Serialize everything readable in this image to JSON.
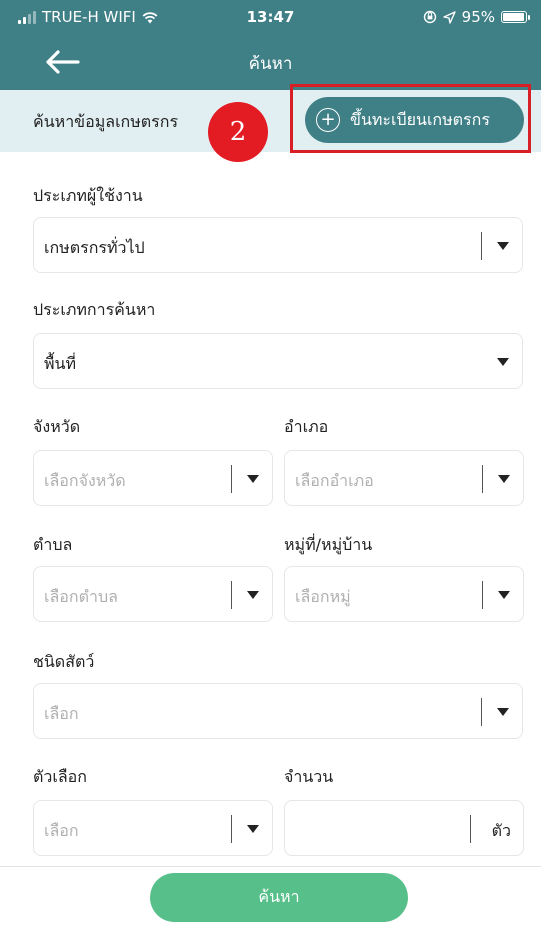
{
  "status_bar": {
    "carrier": "TRUE-H WIFI",
    "time": "13:47",
    "battery": "95%"
  },
  "header": {
    "title": "ค้นหา",
    "back_icon": "arrow-left-icon"
  },
  "subheader": {
    "label": "ค้นหาข้อมูลเกษตรกร",
    "register_button": "ขึ้นทะเบียนเกษตรกร",
    "step_badge": "2"
  },
  "form": {
    "user_type": {
      "label": "ประเภทผู้ใช้งาน",
      "value": "เกษตรกรทั่วไป"
    },
    "search_type": {
      "label": "ประเภทการค้นหา",
      "value": "พื้นที่"
    },
    "province": {
      "label": "จังหวัด",
      "placeholder": "เลือกจังหวัด"
    },
    "district": {
      "label": "อำเภอ",
      "placeholder": "เลือกอำเภอ"
    },
    "subdistrict": {
      "label": "ตำบล",
      "placeholder": "เลือกตำบล"
    },
    "village": {
      "label": "หมู่ที่/หมู่บ้าน",
      "placeholder": "เลือกหมู่"
    },
    "animal_type": {
      "label": "ชนิดสัตว์",
      "placeholder": "เลือก"
    },
    "option": {
      "label": "ตัวเลือก",
      "placeholder": "เลือก"
    },
    "quantity": {
      "label": "จำนวน",
      "unit": "ตัว",
      "value": ""
    }
  },
  "footer": {
    "search_button": "ค้นหา"
  },
  "colors": {
    "header_bg": "#3f7f86",
    "subheader_bg": "#e2eff2",
    "search_button": "#57bf8a",
    "highlight": "#d81f26",
    "badge": "#e31b23"
  }
}
